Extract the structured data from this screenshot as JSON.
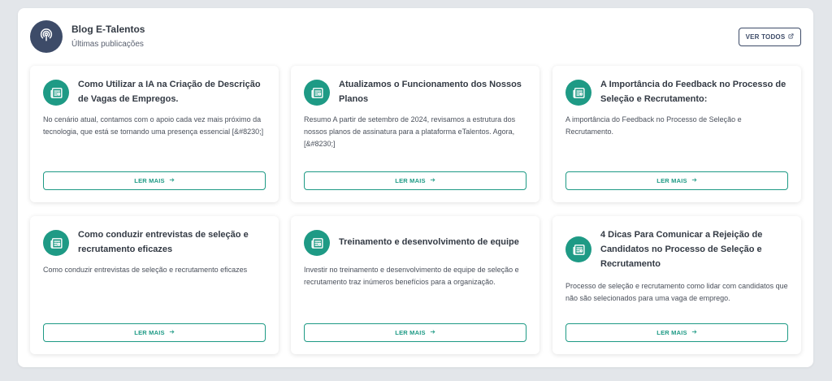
{
  "header": {
    "title": "Blog E-Talentos",
    "subtitle": "Últimas publicações",
    "avatar_icon": "podcast-icon",
    "ver_todos_label": "VER TODOS",
    "ver_todos_icon": "external-link-icon"
  },
  "colors": {
    "accent": "#1e9a85",
    "navy": "#3d4b68",
    "page_background": "#e3e6ea"
  },
  "card_icon": "newspaper-icon",
  "cards": [
    {
      "title": "Como Utilizar a IA na Criação de Descrição de Vagas de Empregos.",
      "description": "No cenário atual, contamos com o apoio cada vez mais próximo da tecnologia, que está se tornando uma presença essencial [&#8230;]",
      "button": "LER MAIS"
    },
    {
      "title": "Atualizamos o Funcionamento dos Nossos Planos",
      "description": "Resumo A partir de setembro de 2024, revisamos a estrutura dos nossos planos de assinatura para a plataforma eTalentos. Agora, [&#8230;]",
      "button": "LER MAIS"
    },
    {
      "title": "A Importância do Feedback no Processo de Seleção e Recrutamento:",
      "description": "A importância do Feedback no Processo de Seleção e Recrutamento.",
      "button": "LER MAIS"
    },
    {
      "title": "Como conduzir entrevistas de seleção e recrutamento eficazes",
      "description": "Como conduzir entrevistas de seleção e recrutamento eficazes",
      "button": "LER MAIS"
    },
    {
      "title": "Treinamento e desenvolvimento de equipe",
      "description": "Investir no treinamento e desenvolvimento de equipe de seleção e recrutamento traz inúmeros benefícios para a organização.",
      "button": "LER MAIS"
    },
    {
      "title": "4 Dicas Para Comunicar a Rejeição de Candidatos no Processo de Seleção e Recrutamento",
      "description": "Processo de seleção e recrutamento como lidar com candidatos que não são selecionados para uma vaga de emprego.",
      "button": "LER MAIS"
    }
  ]
}
